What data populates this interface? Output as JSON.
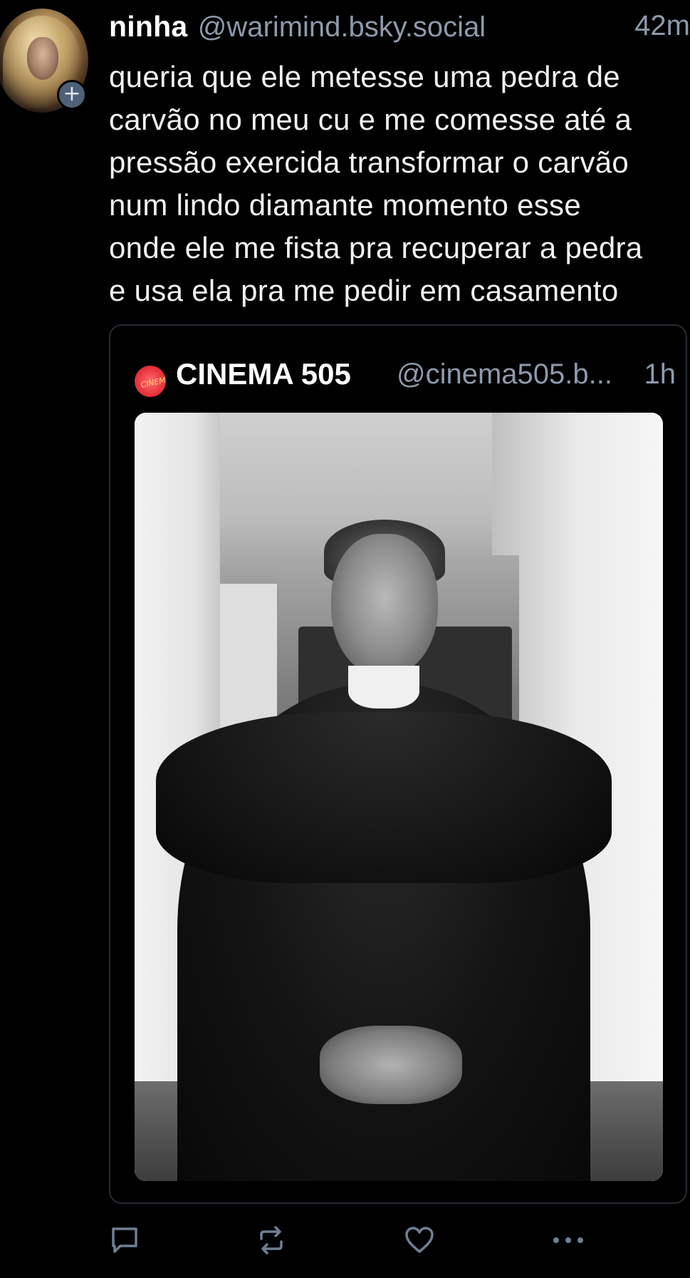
{
  "post": {
    "author_name": "ninha",
    "author_handle": "@warimind.bsky.social",
    "timestamp": "42m",
    "text": "queria que ele metesse uma pedra de\ncarvão no meu cu e me comesse até a\npressão exercida transformar o carvão\nnum lindo diamante momento esse\nonde ele me fista pra recuperar a pedra\ne usa ela pra me pedir em casamento",
    "avatar_badge": "+"
  },
  "quote": {
    "author_name": "CINEMA 505",
    "author_handle": "@cinema505.b...",
    "timestamp": "1h",
    "avatar_text": "CINEMA 505"
  },
  "actions": {
    "reply_icon": "comment-icon",
    "repost_icon": "repost-icon",
    "like_icon": "heart-icon",
    "more_icon": "more-icon"
  },
  "colors": {
    "background": "#000000",
    "muted_text": "#8d9aab",
    "card_border": "#262b33",
    "icon_color": "#6f7f93",
    "avatar_plus_bg": "#4f6178",
    "quote_avatar_red": "#e7343c"
  }
}
